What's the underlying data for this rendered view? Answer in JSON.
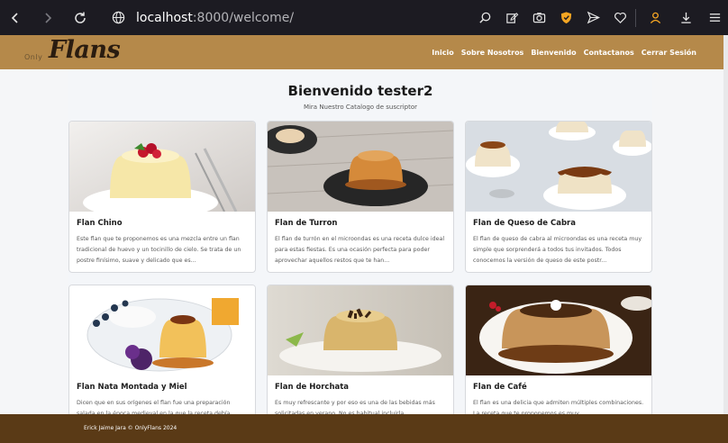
{
  "browser": {
    "url_host": "localhost",
    "url_path": ":8000/welcome/"
  },
  "site": {
    "brand_small": "Only",
    "brand_large": "Flans",
    "nav": [
      "Inicio",
      "Sobre Nosotros",
      "Bienvenido",
      "Contactanos",
      "Cerrar Sesión"
    ]
  },
  "page": {
    "title": "Bienvenido tester2",
    "subtitle": "Mira Nuestro Catalogo de suscriptor"
  },
  "cards": [
    {
      "title": "Flan Chino",
      "desc": "Este flan que te proponemos es una mezcla entre un flan tradicional de huevo y un tocinillo de cielo. Se trata de un postre finísimo, suave y delicado que es..."
    },
    {
      "title": "Flan de Turron",
      "desc": "El flan de turrón en el microondas es una receta dulce ideal para estas fiestas. Es una ocasión perfecta para poder aprovechar aquellos restos que te han..."
    },
    {
      "title": "Flan de Queso de Cabra",
      "desc": "El flan de queso de cabra al microondas es una receta muy simple que sorprenderá a todos tus invitados. Todos conocemos la versión de queso de este postr..."
    },
    {
      "title": "Flan Nata Montada y Miel",
      "desc": "Dicen que en sus orígenes el flan fue una preparación salada en la época medieval en la que la receta debía..."
    },
    {
      "title": "Flan de Horchata",
      "desc": "Es muy refrescante y por eso es una de las bebidas más solicitadas en verano. No es habitual incluirla..."
    },
    {
      "title": "Flan de Café",
      "desc": "El flan es una delicia que admiten múltiples combinaciones. La receta que te proponemos es muy..."
    }
  ],
  "footer": {
    "text": "Erick Jaime Jara © OnlyFlans 2024"
  },
  "colors": {
    "navbar": "#b5894a",
    "footer": "#5a3a16",
    "chrome": "#1c1b22",
    "shield_accent": "#f5a623",
    "account_accent": "#f5a623"
  }
}
